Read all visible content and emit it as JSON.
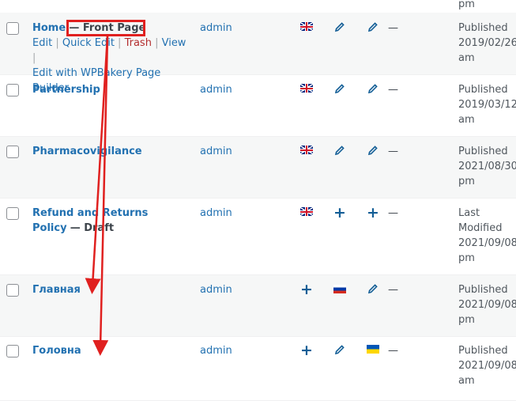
{
  "top_partial": "pm",
  "colors": {
    "link": "#2271b1",
    "annotation": "#e0201f",
    "trash": "#b32d2e"
  },
  "rows": [
    {
      "title": "Home",
      "state": "— Front Page",
      "author": "admin",
      "actions": {
        "edit": "Edit",
        "quick_edit": "Quick Edit",
        "trash": "Trash",
        "view": "View",
        "builder": "Edit with WPBakery Page Builder"
      },
      "langs": [
        "flag-gb",
        "pencil-icon",
        "pencil-icon"
      ],
      "dash": "—",
      "status": "Published",
      "date": "2019/02/26",
      "time": "am"
    },
    {
      "title": "Partnership",
      "author": "admin",
      "langs": [
        "flag-gb",
        "pencil-icon",
        "pencil-icon"
      ],
      "dash": "—",
      "status": "Published",
      "date": "2019/03/12",
      "time": "am"
    },
    {
      "title": "Pharmacovigilance",
      "author": "admin",
      "langs": [
        "flag-gb",
        "pencil-icon",
        "pencil-icon"
      ],
      "dash": "—",
      "status": "Published",
      "date": "2021/08/30",
      "time": "pm"
    },
    {
      "title": "Refund and Returns Policy",
      "state": "— Draft",
      "author": "admin",
      "langs": [
        "flag-gb",
        "plus-icon",
        "plus-icon"
      ],
      "dash": "—",
      "status": "Last Modified",
      "date": "2021/09/08",
      "time": "pm"
    },
    {
      "title": "Главная",
      "author": "admin",
      "langs": [
        "plus-icon",
        "flag-ru",
        "pencil-icon"
      ],
      "dash": "—",
      "status": "Published",
      "date": "2021/09/08",
      "time": "pm"
    },
    {
      "title": "Головна",
      "author": "admin",
      "langs": [
        "plus-icon",
        "pencil-icon",
        "flag-ua"
      ],
      "dash": "—",
      "status": "Published",
      "date": "2021/09/08",
      "time": "am"
    }
  ]
}
